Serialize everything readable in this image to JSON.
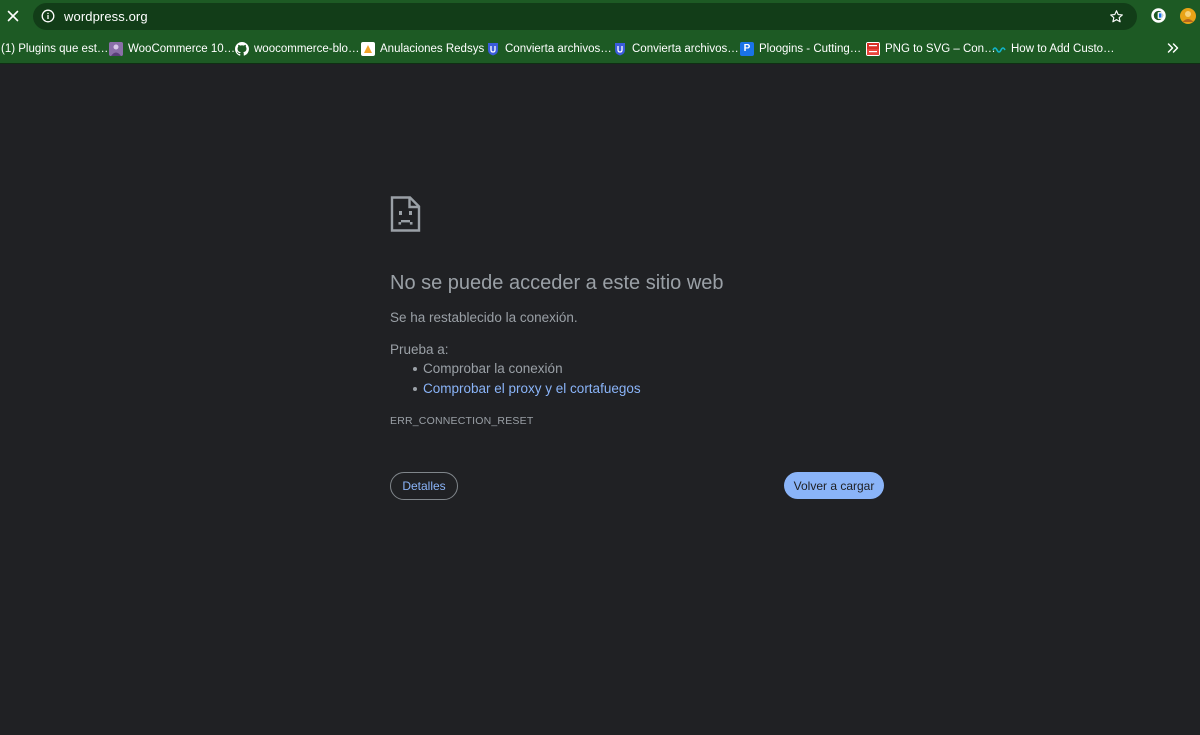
{
  "browser": {
    "url": "wordpress.org",
    "toolbar_icons": [
      "close-icon",
      "info-icon",
      "star-icon",
      "extension-icon",
      "profile-avatar"
    ]
  },
  "bookmarks": [
    {
      "label": "(1) Plugins que est…",
      "icon": "none"
    },
    {
      "label": "WooCommerce 10…",
      "icon": "woocommerce-avatar-icon",
      "color": "#7f54b3"
    },
    {
      "label": "woocommerce-blo…",
      "icon": "github-icon",
      "color": "#ffffff"
    },
    {
      "label": "Anulaciones Redsys",
      "icon": "redsys-icon",
      "color": "#f0a52a"
    },
    {
      "label": "Convierta archivos…",
      "icon": "convert-shield-icon",
      "color": "#3b5bdb"
    },
    {
      "label": "Convierta archivos…",
      "icon": "convert-shield-icon",
      "color": "#3b5bdb"
    },
    {
      "label": "Ploogins - Cutting…",
      "icon": "ploogins-icon",
      "color": "#1a73e8",
      "glyph": "P"
    },
    {
      "label": "PNG to SVG – Con…",
      "icon": "png-svg-icon",
      "color": "#d93025",
      "glyph": "PNG"
    },
    {
      "label": "How to Add Custo…",
      "icon": "wave-icon",
      "color": "#12b5cb"
    }
  ],
  "error_page": {
    "title": "No se puede acceder a este sitio web",
    "subtitle": "Se ha restablecido la conexión.",
    "try_label": "Prueba a:",
    "suggestions": [
      "Comprobar la conexión",
      "Comprobar el proxy y el cortafuegos"
    ],
    "error_code": "ERR_CONNECTION_RESET",
    "details_button": "Detalles",
    "reload_button": "Volver a cargar"
  },
  "colors": {
    "toolbar_bg": "#1d5a24",
    "omnibox_bg": "#123d18",
    "page_bg": "#202124",
    "text_muted": "#9aa0a6",
    "link": "#8ab4f8"
  }
}
